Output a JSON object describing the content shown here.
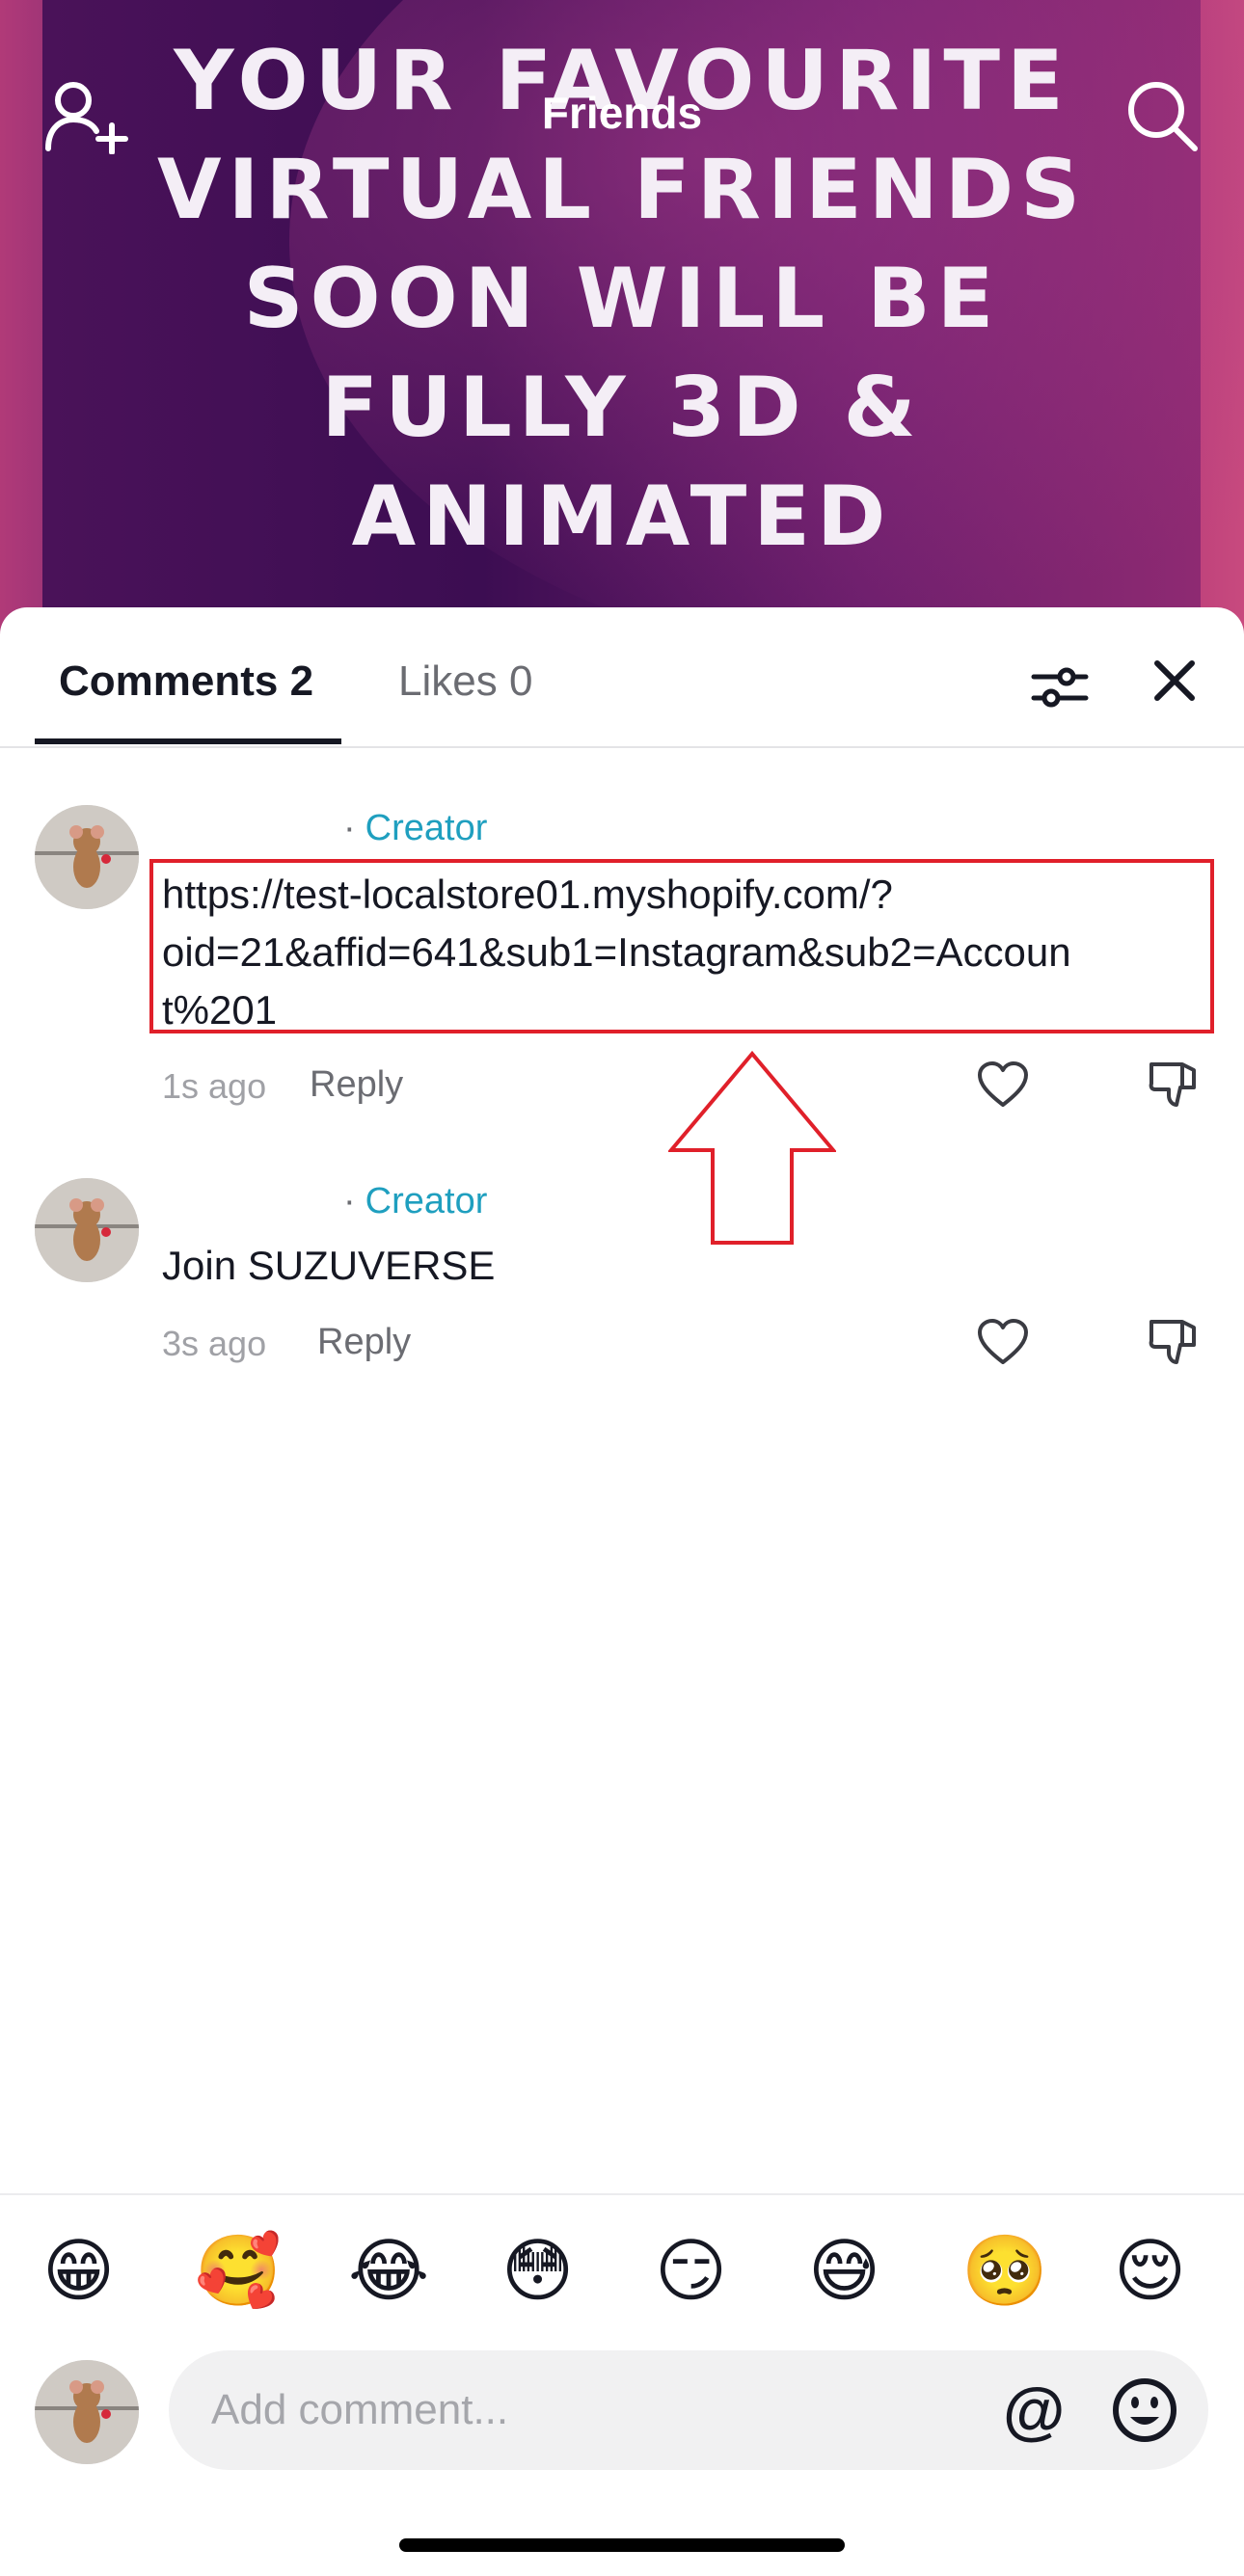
{
  "header": {
    "title": "Friends",
    "video_text": "YOUR FAVOURITE\nVIRTUAL FRIENDS\nSOON WILL BE\nFULLY 3D &\nANIMATED",
    "icons": [
      "add-friend-icon",
      "search-icon"
    ]
  },
  "sheet": {
    "tabs": [
      {
        "label": "Comments 2",
        "active": true
      },
      {
        "label": "Likes 0",
        "active": false
      }
    ],
    "icons": [
      "filter-icon",
      "close-icon"
    ]
  },
  "comments": [
    {
      "creator_label": "Creator",
      "text": "https://test-localstore01.myshopify.com/?\noid=21&affid=641&sub1=Instagram&sub2=Accoun\nt%201",
      "time": "1s ago",
      "reply_label": "Reply"
    },
    {
      "creator_label": "Creator",
      "text": "Join SUZUVERSE",
      "time": "3s ago",
      "reply_label": "Reply"
    }
  ],
  "emojis": [
    "😁",
    "🥰",
    "😂",
    "😳",
    "😏",
    "😅",
    "🥺",
    "😌"
  ],
  "input": {
    "placeholder": "Add comment...",
    "at_symbol": "@"
  },
  "colors": {
    "creator": "#1f9fbf",
    "highlight": "#e0202a",
    "video_bg": "#3c0d52"
  }
}
